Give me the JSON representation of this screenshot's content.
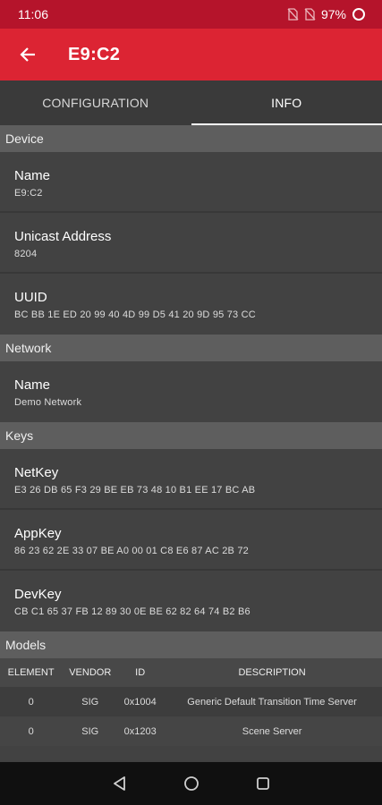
{
  "status": {
    "time": "11:06",
    "battery": "97%"
  },
  "appbar": {
    "title": "E9:C2"
  },
  "tabs": [
    {
      "label": "CONFIGURATION",
      "active": false
    },
    {
      "label": "INFO",
      "active": true
    }
  ],
  "sections": {
    "device": {
      "header": "Device",
      "name": {
        "label": "Name",
        "value": "E9:C2"
      },
      "unicast": {
        "label": "Unicast Address",
        "value": "8204"
      },
      "uuid": {
        "label": "UUID",
        "value": "BC BB 1E ED 20 99 40 4D 99 D5 41 20 9D 95 73 CC"
      }
    },
    "network": {
      "header": "Network",
      "name": {
        "label": "Name",
        "value": "Demo Network"
      }
    },
    "keys": {
      "header": "Keys",
      "netkey": {
        "label": "NetKey",
        "value": "E3 26 DB 65 F3 29 BE EB 73 48 10 B1 EE 17 BC AB"
      },
      "appkey": {
        "label": "AppKey",
        "value": "86 23 62 2E 33 07 BE A0 00 01 C8 E6 87 AC 2B 72"
      },
      "devkey": {
        "label": "DevKey",
        "value": "CB C1 65 37 FB 12 89 30 0E BE 62 82 64 74 B2 B6"
      }
    },
    "models": {
      "header": "Models",
      "columns": [
        "ELEMENT",
        "VENDOR",
        "ID",
        "DESCRIPTION"
      ],
      "rows": [
        [
          "0",
          "SIG",
          "0x1004",
          "Generic Default Transition Time Server"
        ],
        [
          "0",
          "SIG",
          "0x1203",
          "Scene Server"
        ]
      ]
    }
  },
  "colors": {
    "statusbar": "#b5142b",
    "appbar": "#dc2433",
    "background": "#424242",
    "section_header": "#5e5e5e"
  },
  "icons": {
    "back": "arrow-left-icon",
    "nav_back": "triangle-back-icon",
    "nav_home": "circle-home-icon",
    "nav_recents": "square-recents-icon"
  }
}
